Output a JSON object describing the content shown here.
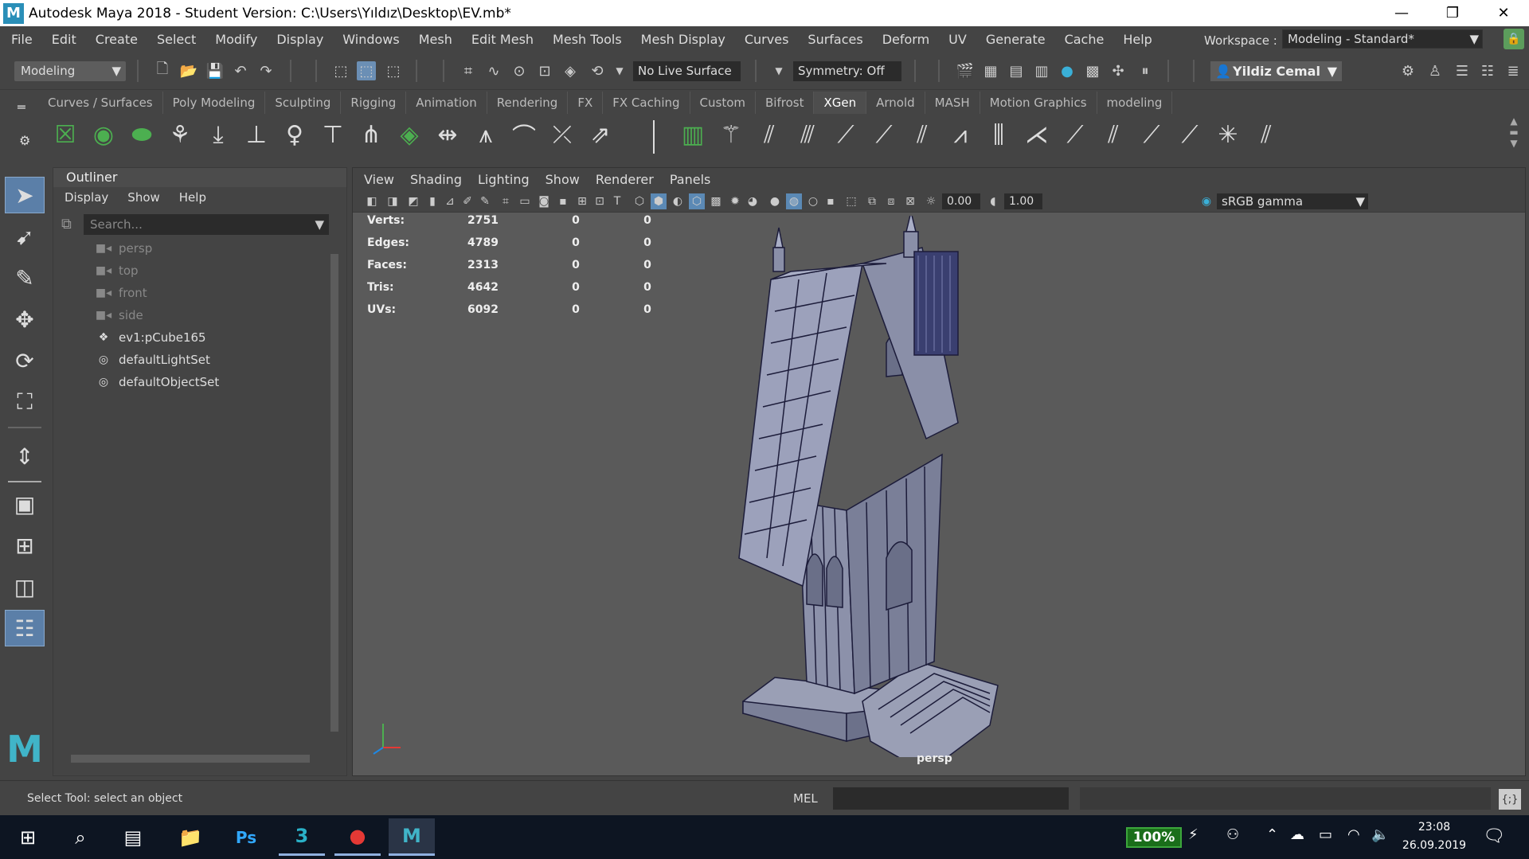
{
  "window": {
    "title": "Autodesk Maya 2018 - Student Version: C:\\Users\\Yıldız\\Desktop\\EV.mb*",
    "controls": [
      "—",
      "❐",
      "✕"
    ]
  },
  "menubar": {
    "items": [
      "File",
      "Edit",
      "Create",
      "Select",
      "Modify",
      "Display",
      "Windows",
      "Mesh",
      "Edit Mesh",
      "Mesh Tools",
      "Mesh Display",
      "Curves",
      "Surfaces",
      "Deform",
      "UV",
      "Generate",
      "Cache",
      "Help"
    ],
    "workspace_label": "Workspace :",
    "workspace_value": "Modeling - Standard*"
  },
  "statusline": {
    "mode": "Modeling",
    "live_surface": "No Live Surface",
    "symmetry": "Symmetry: Off",
    "user": "Yildiz Cemal"
  },
  "shelf": {
    "tabs": [
      "Curves / Surfaces",
      "Poly Modeling",
      "Sculpting",
      "Rigging",
      "Animation",
      "Rendering",
      "FX",
      "FX Caching",
      "Custom",
      "Bifrost",
      "XGen",
      "Arnold",
      "MASH",
      "Motion Graphics",
      "modeling"
    ],
    "active_tab": "XGen"
  },
  "outliner": {
    "title": "Outliner",
    "menu": [
      "Display",
      "Show",
      "Help"
    ],
    "search_placeholder": "Search...",
    "items": [
      {
        "label": "persp",
        "icon": "camera-icon",
        "dim": true
      },
      {
        "label": "top",
        "icon": "camera-icon",
        "dim": true
      },
      {
        "label": "front",
        "icon": "camera-icon",
        "dim": true
      },
      {
        "label": "side",
        "icon": "camera-icon",
        "dim": true
      },
      {
        "label": "ev1:pCube165",
        "icon": "mesh-icon",
        "dim": false
      },
      {
        "label": "defaultLightSet",
        "icon": "set-icon",
        "dim": false
      },
      {
        "label": "defaultObjectSet",
        "icon": "set-icon",
        "dim": false
      }
    ]
  },
  "viewport": {
    "menu": [
      "View",
      "Shading",
      "Lighting",
      "Show",
      "Renderer",
      "Panels"
    ],
    "exposure": "0.00",
    "gamma": "1.00",
    "color_space": "sRGB gamma",
    "camera_label": "persp",
    "hud": [
      {
        "label": "Verts:",
        "v1": "2751",
        "v2": "0",
        "v3": "0"
      },
      {
        "label": "Edges:",
        "v1": "4789",
        "v2": "0",
        "v3": "0"
      },
      {
        "label": "Faces:",
        "v1": "2313",
        "v2": "0",
        "v3": "0"
      },
      {
        "label": "Tris:",
        "v1": "4642",
        "v2": "0",
        "v3": "0"
      },
      {
        "label": "UVs:",
        "v1": "6092",
        "v2": "0",
        "v3": "0"
      }
    ]
  },
  "cmdline": {
    "help_text": "Select Tool: select an object",
    "mel_label": "MEL"
  },
  "taskbar": {
    "battery": "100%",
    "time": "23:08",
    "date": "26.09.2019",
    "apps": [
      "windows-start",
      "search",
      "task-view",
      "file-explorer",
      "photoshop",
      "3dsmax",
      "app-red",
      "maya"
    ]
  },
  "colors": {
    "accent": "#5b89b5",
    "battery_green": "#3ca63c",
    "maya_teal": "#40b4c8"
  }
}
